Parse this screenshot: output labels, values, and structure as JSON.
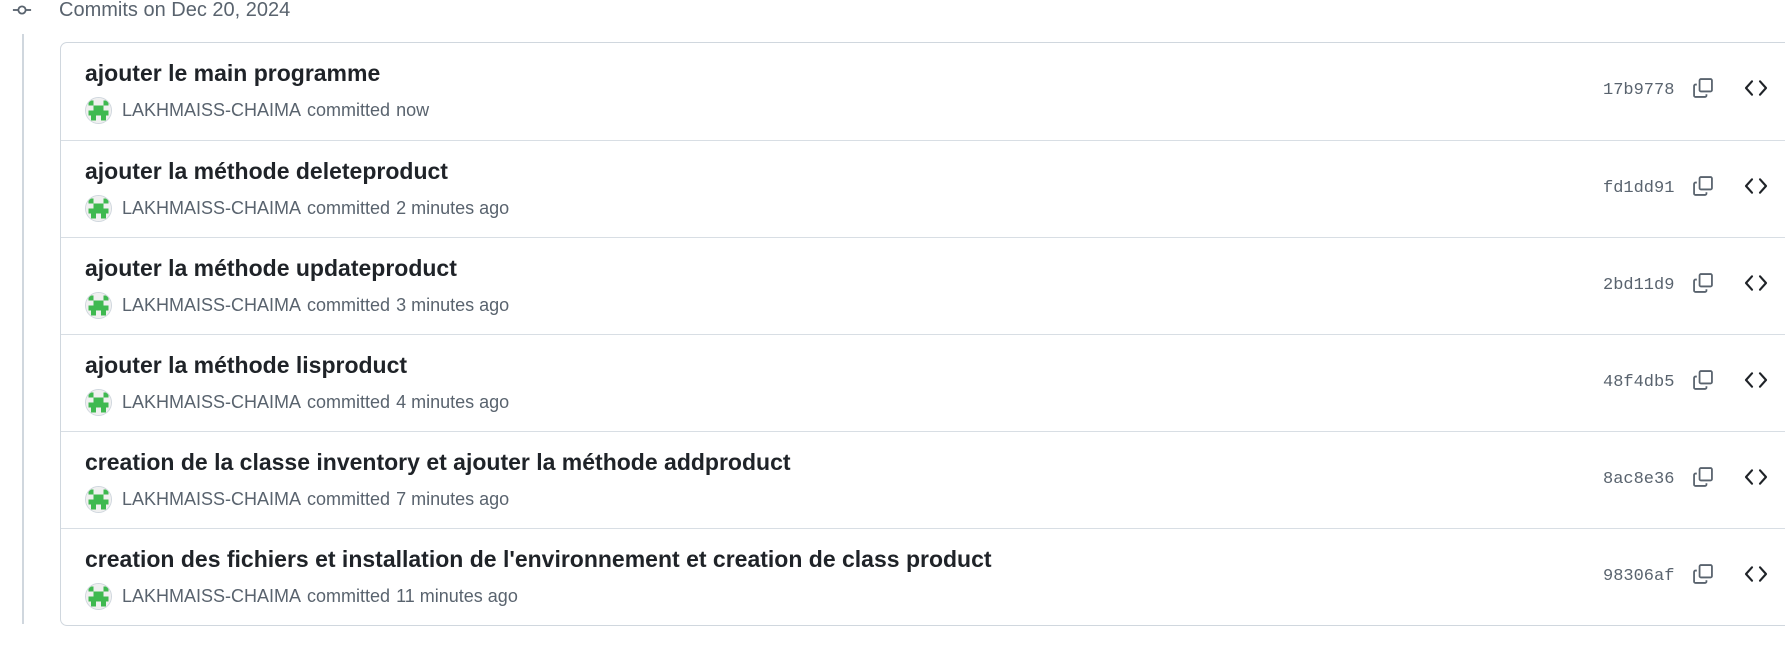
{
  "group": {
    "title": "Commits on Dec 20, 2024",
    "icon": "git-commit-icon"
  },
  "commits": [
    {
      "title": "ajouter le main programme",
      "author": "LAKHMAISS-CHAIMA",
      "committed_label": "committed",
      "time": "now",
      "sha": "17b9778"
    },
    {
      "title": "ajouter la méthode deleteproduct",
      "author": "LAKHMAISS-CHAIMA",
      "committed_label": "committed",
      "time": "2 minutes ago",
      "sha": "fd1dd91"
    },
    {
      "title": "ajouter la méthode updateproduct",
      "author": "LAKHMAISS-CHAIMA",
      "committed_label": "committed",
      "time": "3 minutes ago",
      "sha": "2bd11d9"
    },
    {
      "title": "ajouter la méthode lisproduct",
      "author": "LAKHMAISS-CHAIMA",
      "committed_label": "committed",
      "time": "4 minutes ago",
      "sha": "48f4db5"
    },
    {
      "title": "creation de la classe inventory et ajouter la méthode addproduct",
      "author": "LAKHMAISS-CHAIMA",
      "committed_label": "committed",
      "time": "7 minutes ago",
      "sha": "8ac8e36"
    },
    {
      "title": "creation des fichiers et installation de l'environnement et creation de class product",
      "author": "LAKHMAISS-CHAIMA",
      "committed_label": "committed",
      "time": "11 minutes ago",
      "sha": "98306af"
    }
  ],
  "icons": {
    "copy": "copy-icon",
    "browse": "code-brackets-icon",
    "avatar": "identicon-avatar"
  },
  "colors": {
    "text_primary": "#1f2328",
    "text_muted": "#59636e",
    "border": "#d0d7de",
    "identicon_green": "#3fb950"
  }
}
